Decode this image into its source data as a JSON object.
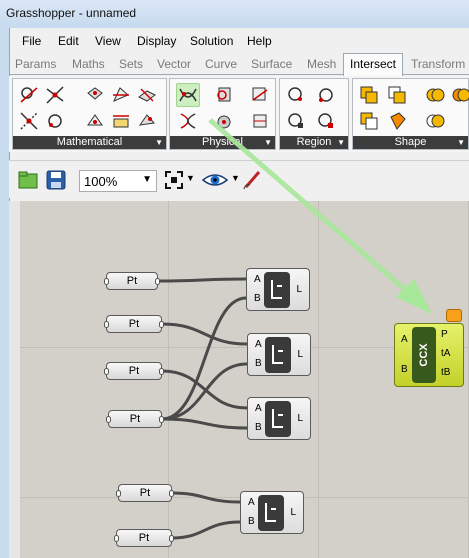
{
  "window": {
    "title": "Grasshopper - unnamed"
  },
  "menubar": [
    "File",
    "Edit",
    "View",
    "Display",
    "Solution",
    "Help"
  ],
  "tabs": [
    {
      "label": "Params",
      "active": false
    },
    {
      "label": "Maths",
      "active": false
    },
    {
      "label": "Sets",
      "active": false
    },
    {
      "label": "Vector",
      "active": false
    },
    {
      "label": "Curve",
      "active": false
    },
    {
      "label": "Surface",
      "active": false
    },
    {
      "label": "Mesh",
      "active": false
    },
    {
      "label": "Intersect",
      "active": true
    },
    {
      "label": "Transform",
      "active": false
    }
  ],
  "ribbon_groups": [
    "Mathematical",
    "Physical",
    "Region",
    "Shape"
  ],
  "toolbar": {
    "zoom": "100%"
  },
  "canvas": {
    "point_label": "Pt",
    "line": {
      "input_a": "A",
      "input_b": "B",
      "output": "L"
    },
    "ccx": {
      "name": "CCX",
      "input_a": "A",
      "input_b": "B",
      "out_p": "P",
      "out_ta": "tA",
      "out_tb": "tB"
    }
  },
  "colors": {
    "accent_arrow": "#a8e89a",
    "ccx_body": "#d5e23c",
    "ccx_core": "#375a1c",
    "warning_bubble": "#f7a21a"
  }
}
